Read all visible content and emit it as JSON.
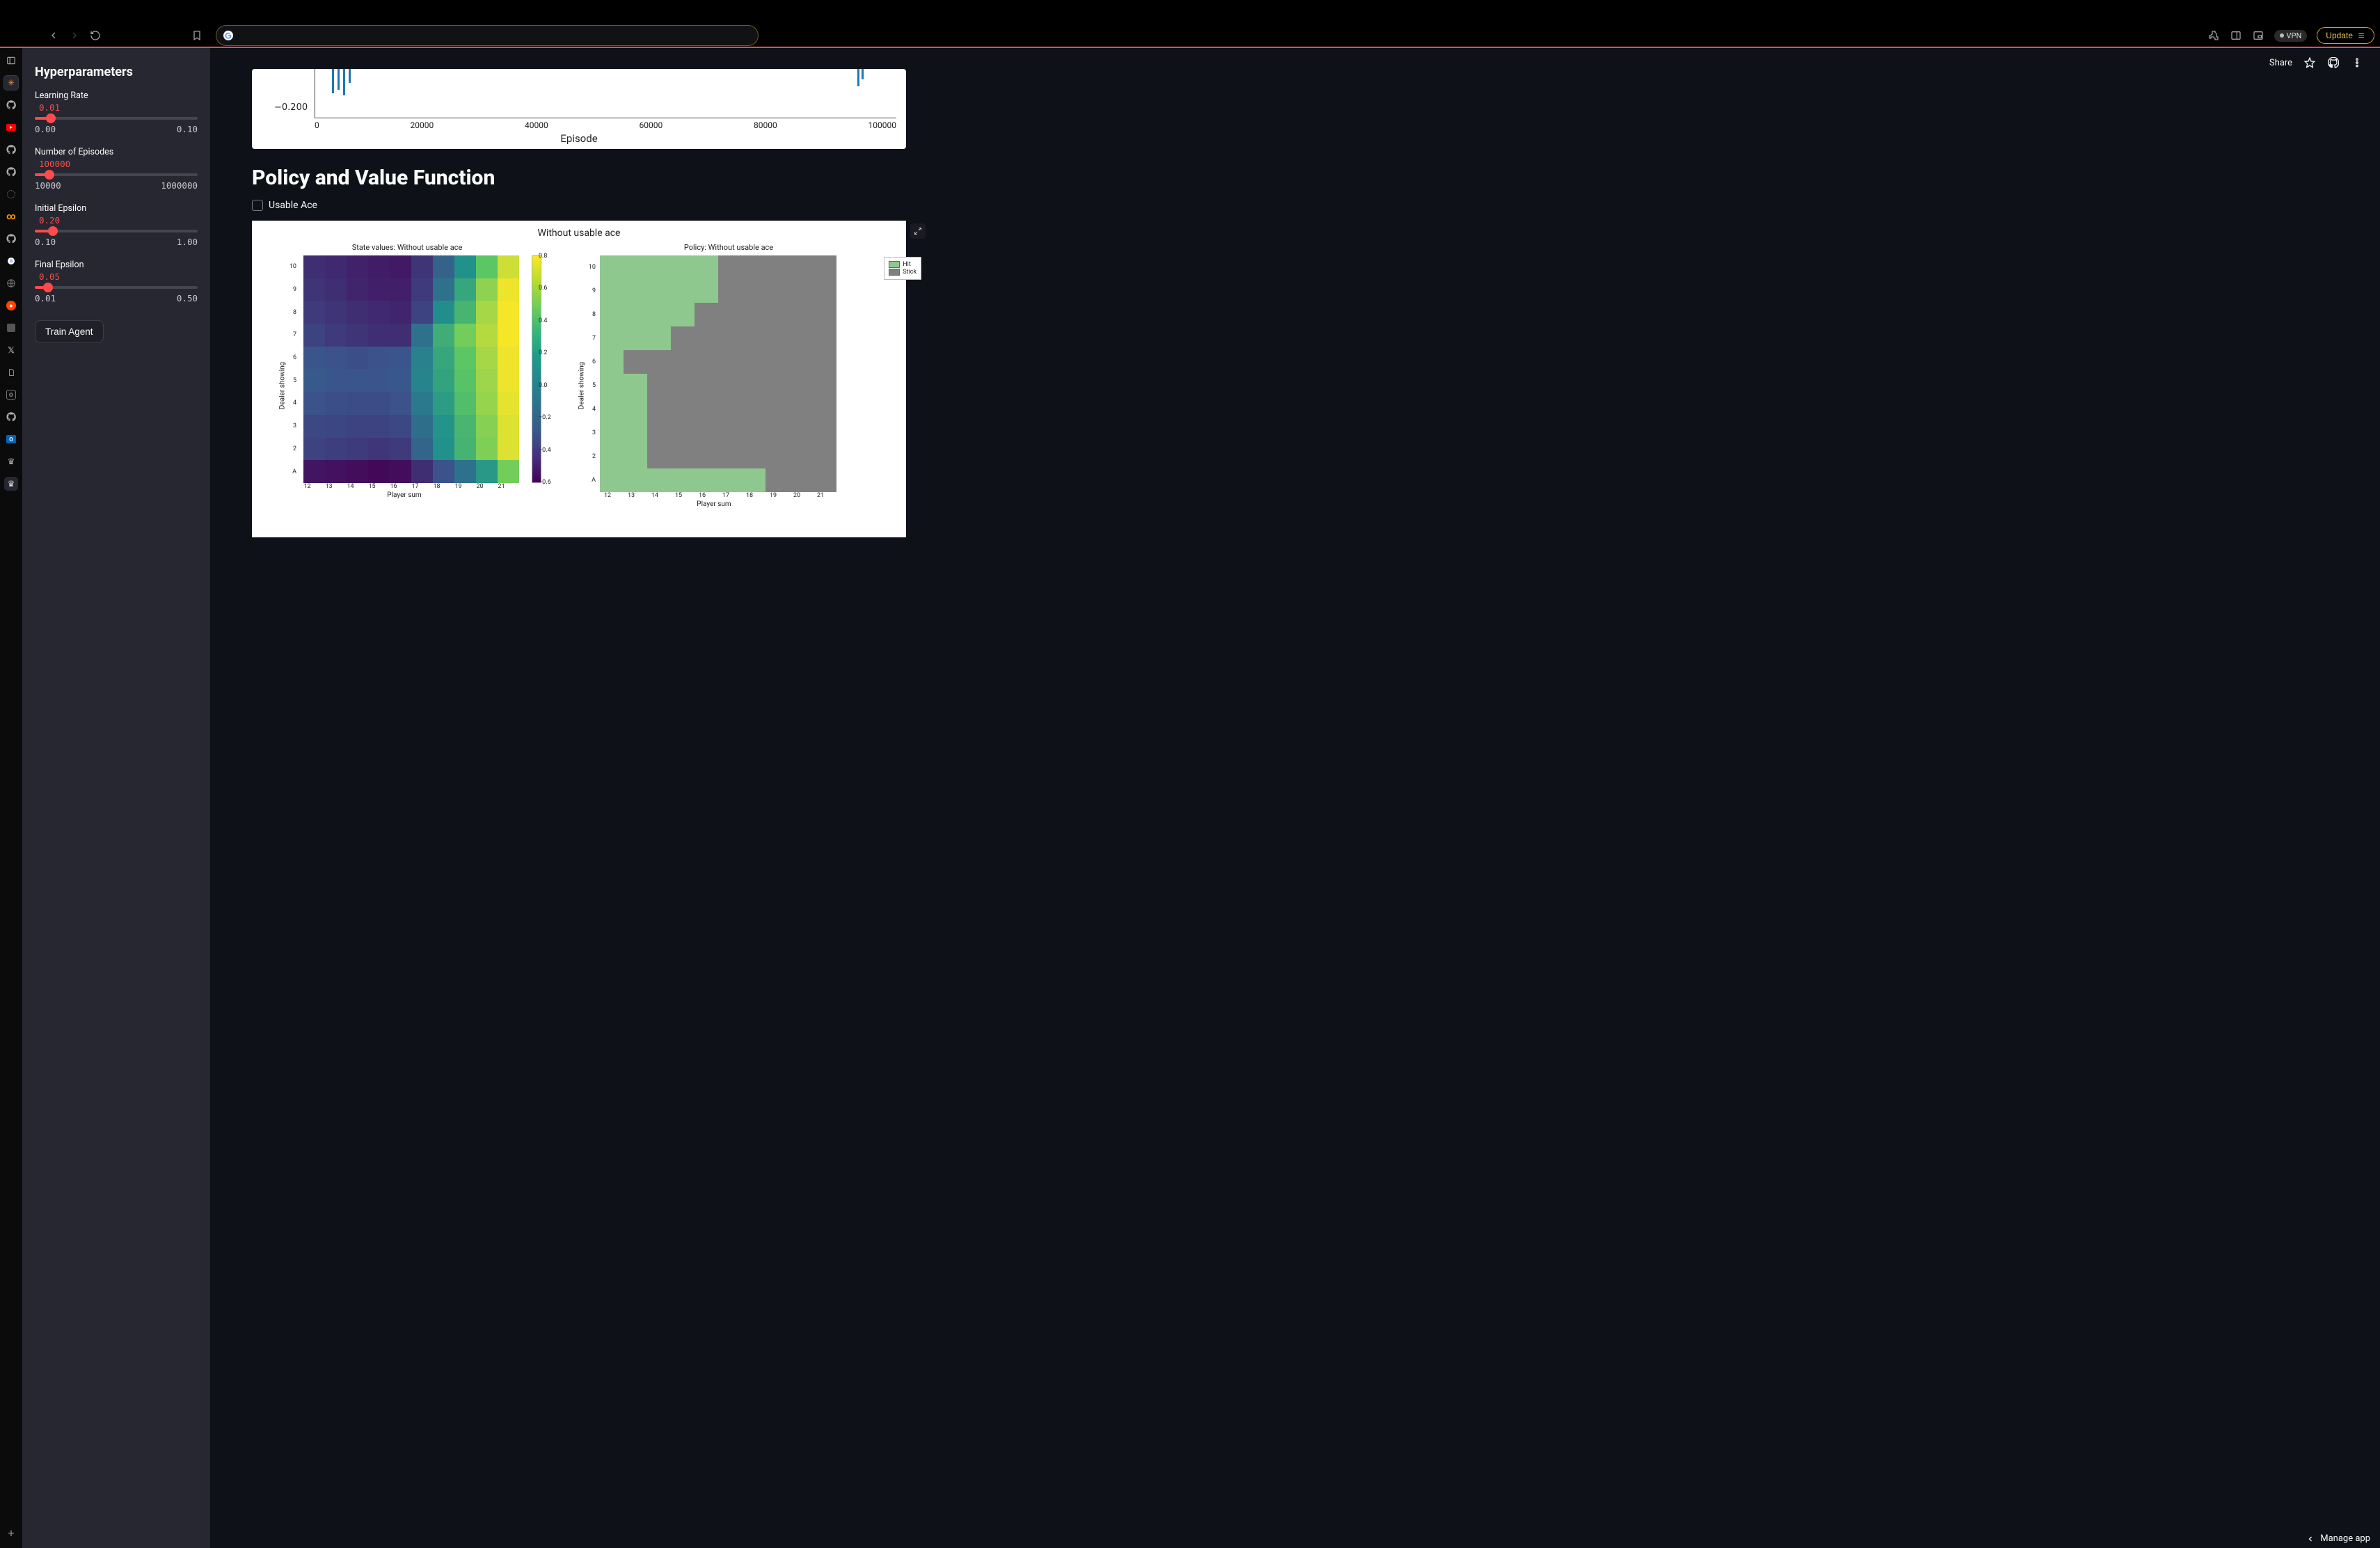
{
  "browser": {
    "vpn_label": "VPN",
    "update_label": "Update"
  },
  "top_actions": {
    "share": "Share"
  },
  "sidebar": {
    "title": "Hyperparameters",
    "params": [
      {
        "label": "Learning Rate",
        "value_str": "0.01",
        "min_str": "0.00",
        "max_str": "0.10",
        "pct": 10
      },
      {
        "label": "Number of Episodes",
        "value_str": "100000",
        "min_str": "10000",
        "max_str": "1000000",
        "pct": 9
      },
      {
        "label": "Initial Epsilon",
        "value_str": "0.20",
        "min_str": "0.10",
        "max_str": "1.00",
        "pct": 11
      },
      {
        "label": "Final Epsilon",
        "value_str": "0.05",
        "min_str": "0.01",
        "max_str": "0.50",
        "pct": 8
      }
    ],
    "train_button": "Train Agent"
  },
  "upper_chart_stub": {
    "y_tick": "−0.200",
    "x_ticks": [
      "0",
      "20000",
      "40000",
      "60000",
      "80000",
      "100000"
    ],
    "x_label": "Episode"
  },
  "section_title": "Policy and Value Function",
  "checkbox_label": "Usable Ace",
  "figure": {
    "suptitle": "Without usable ace",
    "heatmap": {
      "title": "State values: Without usable ace",
      "xlabel": "Player sum",
      "ylabel": "Dealer showing"
    },
    "policy": {
      "title": "Policy: Without usable ace",
      "xlabel": "Player sum",
      "ylabel": "Dealer showing",
      "legend": {
        "hit": "Hit",
        "stick": "Stick"
      }
    }
  },
  "status_bar": {
    "manage": "Manage app"
  },
  "chart_data": [
    {
      "type": "heatmap",
      "title": "State values: Without usable ace",
      "xlabel": "Player sum",
      "ylabel": "Dealer showing",
      "x": [
        12,
        13,
        14,
        15,
        16,
        17,
        18,
        19,
        20,
        21
      ],
      "y": [
        10,
        9,
        8,
        7,
        6,
        5,
        4,
        3,
        2,
        "A"
      ],
      "zlim": [
        -0.7,
        0.9
      ],
      "colorbar_ticks": [
        0.8,
        0.6,
        0.4,
        0.2,
        0.0,
        -0.2,
        -0.4,
        -0.6
      ],
      "values": [
        [
          -0.48,
          -0.5,
          -0.54,
          -0.56,
          -0.58,
          -0.45,
          -0.2,
          0.1,
          0.48,
          0.78
        ],
        [
          -0.45,
          -0.48,
          -0.52,
          -0.55,
          -0.55,
          -0.42,
          -0.1,
          0.25,
          0.62,
          0.86
        ],
        [
          -0.42,
          -0.45,
          -0.48,
          -0.5,
          -0.52,
          -0.38,
          0.08,
          0.35,
          0.68,
          0.88
        ],
        [
          -0.38,
          -0.42,
          -0.45,
          -0.48,
          -0.48,
          -0.1,
          0.3,
          0.55,
          0.72,
          0.88
        ],
        [
          -0.28,
          -0.3,
          -0.32,
          -0.3,
          -0.28,
          0.0,
          0.25,
          0.48,
          0.68,
          0.86
        ],
        [
          -0.25,
          -0.28,
          -0.28,
          -0.28,
          -0.26,
          0.02,
          0.22,
          0.46,
          0.66,
          0.86
        ],
        [
          -0.3,
          -0.32,
          -0.33,
          -0.33,
          -0.3,
          -0.05,
          0.18,
          0.42,
          0.64,
          0.84
        ],
        [
          -0.35,
          -0.36,
          -0.38,
          -0.38,
          -0.35,
          -0.12,
          0.12,
          0.36,
          0.6,
          0.82
        ],
        [
          -0.38,
          -0.4,
          -0.42,
          -0.44,
          -0.42,
          -0.18,
          0.1,
          0.34,
          0.58,
          0.82
        ],
        [
          -0.6,
          -0.62,
          -0.64,
          -0.66,
          -0.64,
          -0.48,
          -0.3,
          -0.1,
          0.15,
          0.55
        ]
      ]
    },
    {
      "type": "heatmap",
      "title": "Policy: Without usable ace",
      "xlabel": "Player sum",
      "ylabel": "Dealer showing",
      "x": [
        12,
        13,
        14,
        15,
        16,
        17,
        18,
        19,
        20,
        21
      ],
      "y": [
        10,
        9,
        8,
        7,
        6,
        5,
        4,
        3,
        2,
        "A"
      ],
      "categories": [
        "Hit",
        "Stick"
      ],
      "values": [
        [
          0,
          0,
          0,
          0,
          0,
          1,
          1,
          1,
          1,
          1
        ],
        [
          0,
          0,
          0,
          0,
          0,
          1,
          1,
          1,
          1,
          1
        ],
        [
          0,
          0,
          0,
          0,
          1,
          1,
          1,
          1,
          1,
          1
        ],
        [
          0,
          0,
          0,
          1,
          1,
          1,
          1,
          1,
          1,
          1
        ],
        [
          0,
          1,
          1,
          1,
          1,
          1,
          1,
          1,
          1,
          1
        ],
        [
          0,
          0,
          1,
          1,
          1,
          1,
          1,
          1,
          1,
          1
        ],
        [
          0,
          0,
          1,
          1,
          1,
          1,
          1,
          1,
          1,
          1
        ],
        [
          0,
          0,
          1,
          1,
          1,
          1,
          1,
          1,
          1,
          1
        ],
        [
          0,
          0,
          1,
          1,
          1,
          1,
          1,
          1,
          1,
          1
        ],
        [
          0,
          0,
          0,
          0,
          0,
          0,
          0,
          1,
          1,
          1
        ]
      ]
    },
    {
      "type": "line",
      "note": "partial (bottom edge of a cropped training curve)",
      "xlabel": "Episode",
      "x_ticks": [
        0,
        20000,
        40000,
        60000,
        80000,
        100000
      ],
      "y_tick_visible": -0.2,
      "xlim": [
        0,
        100000
      ]
    }
  ]
}
